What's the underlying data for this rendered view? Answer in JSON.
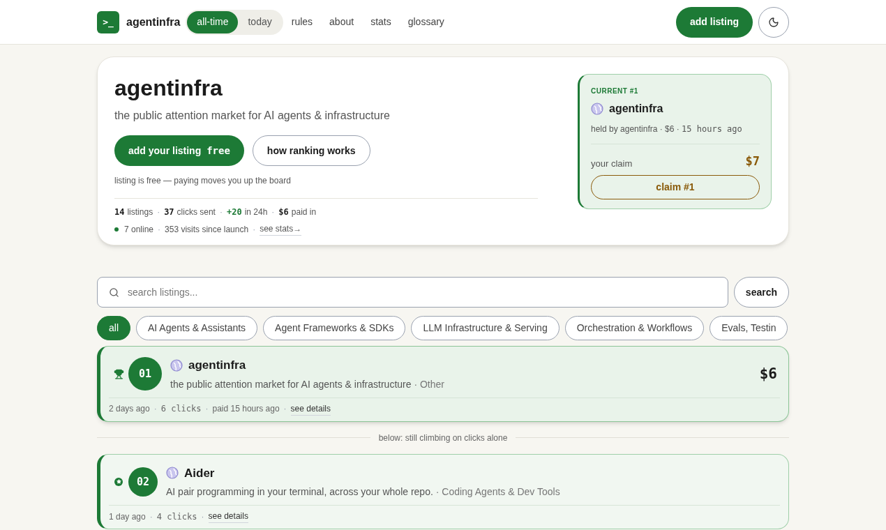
{
  "separator": "·",
  "nav": {
    "logo_mark": ">_",
    "brand": "agentinfra",
    "range_tabs": [
      {
        "label": "all-time",
        "selected": true
      },
      {
        "label": "today",
        "selected": false
      }
    ],
    "links": [
      "rules",
      "about",
      "stats",
      "glossary"
    ],
    "add_button": "add listing"
  },
  "hero": {
    "title": "agentinfra",
    "subtitle": "the public attention market for AI agents & infrastructure",
    "primary_button": "add your listing",
    "primary_badge": "free",
    "secondary_button": "how ranking works",
    "note": "listing is free — paying moves you up the board",
    "stats": [
      {
        "figure": "14",
        "caption": "listings",
        "kind": "count"
      },
      {
        "figure": "37",
        "caption": "clicks sent",
        "kind": "count"
      },
      {
        "figure": "+20",
        "caption": "in 24h",
        "kind": "delta"
      },
      {
        "figure": "$6",
        "caption": "paid in",
        "kind": "count"
      }
    ],
    "online": "7 online",
    "visits": "353 visits since launch",
    "stats_link": "see stats→"
  },
  "current": {
    "eyebrow": "CURRENT #1",
    "name": "agentinfra",
    "held_by": "held by agentinfra · $6 ·",
    "held_time": "15 hours ago",
    "claim_label": "your claim",
    "claim_price": "$7",
    "claim_button": "claim #1"
  },
  "search": {
    "placeholder": "search listings...",
    "button": "search"
  },
  "categories": [
    {
      "label": "all",
      "selected": true
    },
    {
      "label": "AI Agents & Assistants",
      "selected": false
    },
    {
      "label": "Agent Frameworks & SDKs",
      "selected": false
    },
    {
      "label": "LLM Infrastructure & Serving",
      "selected": false
    },
    {
      "label": "Orchestration & Workflows",
      "selected": false
    },
    {
      "label": "Evals, Testin",
      "selected": false
    }
  ],
  "listings": [
    {
      "kind": "paid",
      "rank": "01",
      "name": "agentinfra",
      "description": "the public attention market for AI agents & infrastructure",
      "category": "Other",
      "price": "$6",
      "age": "2 days ago",
      "clicks": "6 clicks",
      "paid": "paid 15 hours ago",
      "link": "see details"
    },
    {
      "kind": "divider",
      "label": "below: still climbing on clicks alone"
    },
    {
      "kind": "climbing",
      "rank": "02",
      "name": "Aider",
      "description": "AI pair programming in your terminal, across your whole repo.",
      "category": "Coding Agents & Dev Tools",
      "age": "1 day ago",
      "clicks": "4 clicks",
      "link": "see details"
    }
  ]
}
